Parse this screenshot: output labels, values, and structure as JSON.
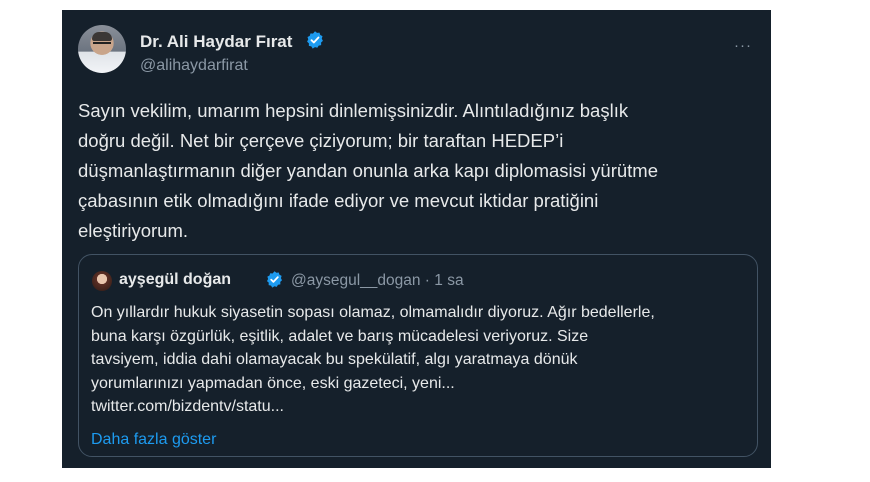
{
  "tweet": {
    "author": {
      "name": "Dr. Ali Haydar Fırat",
      "handle": "@alihaydarfirat",
      "avatar_icon": "profile-photo",
      "verified_icon": "verified-badge-icon"
    },
    "more_icon": "···",
    "text_lines": [
      "Sayın vekilim, umarım hepsini dinlemişsinizdir. Alıntıladığınız başlık",
      "doğru değil. Net bir çerçeve çiziyorum; bir taraftan HEDEP’i",
      "düşmanlaştırmanın diğer yandan onunla arka kapı diplomasisi yürütme",
      "çabasının etik olmadığını ifade ediyor ve mevcut iktidar pratiğini",
      "eleştiriyorum."
    ],
    "quoted": {
      "name": "ayşegül doğan",
      "handle_time": "@aysegul__dogan · 1 sa",
      "text_lines": [
        "On yıllardır hukuk siyasetin sopası olamaz, olmamalıdır diyoruz. Ağır bedellerle,",
        "buna karşı özgürlük, eşitlik, adalet ve barış mücadelesi veriyoruz. Size",
        "tavsiyem, iddia dahi olamayacak bu spekülatif, algı yaratmaya dönük",
        "yorumlarınızı yapmadan önce, eski gazeteci, yeni...",
        "twitter.com/bizdentv/statu..."
      ],
      "show_more": "Daha fazla göster"
    }
  },
  "colors": {
    "background": "#15202b",
    "page": "#ffffff",
    "text": "#e7e9ea",
    "secondary": "#8b98a5",
    "link": "#1d9bf0",
    "verified": "#1d9bf0",
    "quote_border": "#425364"
  }
}
